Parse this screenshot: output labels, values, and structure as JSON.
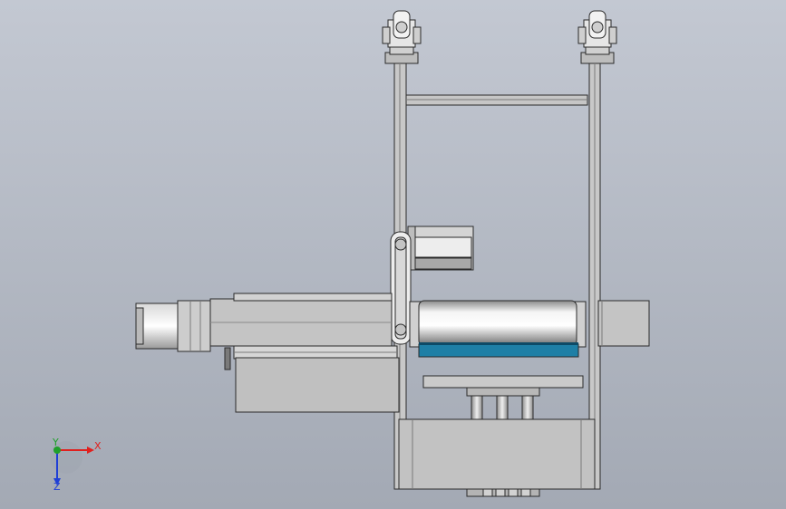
{
  "view": {
    "background_top": "#c3c8d2",
    "background_bottom": "#a3a9b4",
    "part_fill": "#c2c2c2",
    "part_fill_dark": "#a9a9a9",
    "edge_color": "#2a2a2a",
    "belt_color": "#1e7fa6"
  },
  "triad": {
    "x_label": "X",
    "y_label": "Y",
    "z_label": "Z",
    "x_color": "#e0201e",
    "y_color": "#1fa02a",
    "z_color": "#1f3fd6"
  }
}
